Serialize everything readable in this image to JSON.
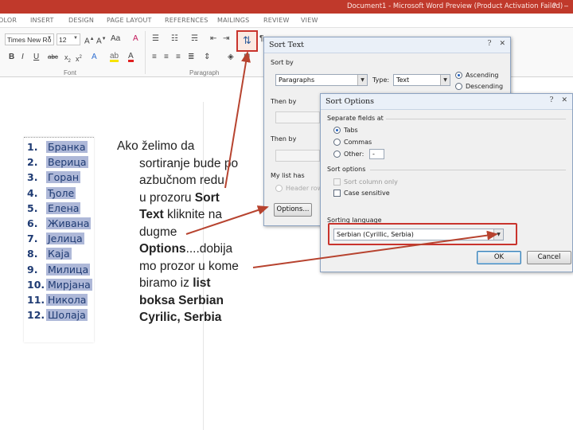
{
  "window": {
    "title": "Document1 - Microsoft Word Preview (Product Activation Failed)",
    "tabs": [
      "OLOR",
      "INSERT",
      "DESIGN",
      "PAGE LAYOUT",
      "REFERENCES",
      "MAILINGS",
      "REVIEW",
      "VIEW"
    ]
  },
  "ribbon": {
    "font_name": "Times New Ro",
    "font_size": "12",
    "group_font": "Font",
    "group_paragraph": "Paragraph",
    "icons": [
      "bold-icon",
      "italic-icon",
      "underline-icon",
      "strikethrough-icon",
      "subscript-icon",
      "superscript-icon",
      "text-effects-icon",
      "highlight-icon",
      "font-color-icon",
      "align-left-icon",
      "center-icon",
      "align-right-icon",
      "justify-icon",
      "line-spacing-icon",
      "shading-icon",
      "borders-icon",
      "sort-icon",
      "grow-font-icon",
      "shrink-font-icon",
      "change-case-icon",
      "clear-formatting-icon",
      "bullets-icon",
      "numbering-icon",
      "multilevel-icon",
      "decrease-indent-icon",
      "increase-indent-icon",
      "pilcrow-icon"
    ]
  },
  "list": [
    {
      "num": "1.",
      "text": "Бранка"
    },
    {
      "num": "2.",
      "text": "Верица"
    },
    {
      "num": "3.",
      "text": "Горан"
    },
    {
      "num": "4.",
      "text": "Ђоле"
    },
    {
      "num": "5.",
      "text": "Елена"
    },
    {
      "num": "6.",
      "text": "Живана"
    },
    {
      "num": "7.",
      "text": "Јелица"
    },
    {
      "num": "8.",
      "text": "Каја"
    },
    {
      "num": "9.",
      "text": "Милица"
    },
    {
      "num": "10.",
      "text": "Мирјана"
    },
    {
      "num": "11.",
      "text": "Никола"
    },
    {
      "num": "12.",
      "text": "Шолаја"
    }
  ],
  "explanation": {
    "l1": "Ako želimo da",
    "l2": "sortiranje bude po",
    "l3": "azbučnom redu",
    "l4a": "u prozoru ",
    "l4b": "Sort",
    "l5a": "Text",
    "l5b": " kliknite na",
    "l6": "dugme",
    "l7a": "Options",
    "l7b": "....dobija",
    "l8": "mo prozor u kome",
    "l9a": "biramo iz ",
    "l9b": "list",
    "l10": "boksa Serbian",
    "l11": "Cyrilic, Serbia"
  },
  "sort_text": {
    "title": "Sort Text",
    "sort_by": "Sort by",
    "sort_by_value": "Paragraphs",
    "type_label": "Type:",
    "type_value": "Text",
    "ascending": "Ascending",
    "descending": "Descending",
    "then_by": "Then by",
    "then_by2": "Then by",
    "list_has": "My list has",
    "header_row": "Header row",
    "options_button": "Options..."
  },
  "sort_options": {
    "title": "Sort Options",
    "separate_fields": "Separate fields at",
    "tabs": "Tabs",
    "commas": "Commas",
    "other": "Other:",
    "other_value": "-",
    "sort_options_label": "Sort options",
    "sort_column_only": "Sort column only",
    "case_sensitive": "Case sensitive",
    "sorting_language": "Sorting language",
    "language_value": "Serbian (Cyrillic, Serbia)",
    "ok": "OK",
    "cancel": "Cancel"
  },
  "colors": {
    "accent_red": "#c9342d",
    "title_bar": "#c0392b",
    "list_highlight": "#aeb8d8"
  }
}
